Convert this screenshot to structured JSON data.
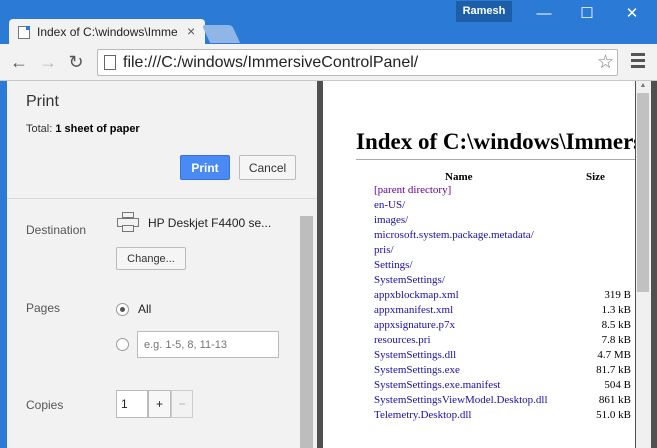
{
  "browser": {
    "tab_title": "Index of C:\\windows\\Immer",
    "tab_close": "×",
    "profile_name": "Ramesh",
    "window_controls": {
      "minimize": "—",
      "maximize": "☐",
      "close": "✕"
    },
    "url": "file:///C:/windows/ImmersiveControlPanel/",
    "nav": {
      "back": "←",
      "forward": "→",
      "reload": "↻"
    },
    "star": "☆",
    "icons": [
      "page-icon",
      "back-icon",
      "forward-icon",
      "reload-icon",
      "star-icon",
      "menu-icon",
      "close-icon"
    ]
  },
  "print_panel": {
    "title": "Print",
    "total_prefix": "Total:",
    "total_value": "1 sheet of paper",
    "print_button": "Print",
    "cancel_button": "Cancel",
    "destination_label": "Destination",
    "printer_name": "HP Deskjet F4400 se...",
    "change_button": "Change...",
    "pages_label": "Pages",
    "pages_all": "All",
    "pages_placeholder": "e.g. 1-5, 8, 11-13",
    "copies_label": "Copies",
    "copies_value": "1",
    "copies_plus": "+",
    "copies_minus": "−"
  },
  "preview": {
    "heading": "Index of C:\\windows\\Immersive",
    "col_name": "Name",
    "col_size": "Size",
    "files": [
      {
        "name": "[parent directory]",
        "size": ""
      },
      {
        "name": "en-US/",
        "size": ""
      },
      {
        "name": "images/",
        "size": ""
      },
      {
        "name": "microsoft.system.package.metadata/",
        "size": ""
      },
      {
        "name": "pris/",
        "size": ""
      },
      {
        "name": "Settings/",
        "size": ""
      },
      {
        "name": "SystemSettings/",
        "size": ""
      },
      {
        "name": "appxblockmap.xml",
        "size": "319 B"
      },
      {
        "name": "appxmanifest.xml",
        "size": "1.3 kB"
      },
      {
        "name": "appxsignature.p7x",
        "size": "8.5 kB"
      },
      {
        "name": "resources.pri",
        "size": "7.8 kB"
      },
      {
        "name": "SystemSettings.dll",
        "size": "4.7 MB"
      },
      {
        "name": "SystemSettings.exe",
        "size": "81.7 kB"
      },
      {
        "name": "SystemSettings.exe.manifest",
        "size": "504 B"
      },
      {
        "name": "SystemSettingsViewModel.Desktop.dll",
        "size": "861 kB"
      },
      {
        "name": "Telemetry.Desktop.dll",
        "size": "51.0 kB"
      }
    ]
  },
  "colors": {
    "titlebar": "#2b7bd6",
    "print_button": "#4a8af4",
    "link": "#1a0dab",
    "visited_link": "#660099"
  }
}
